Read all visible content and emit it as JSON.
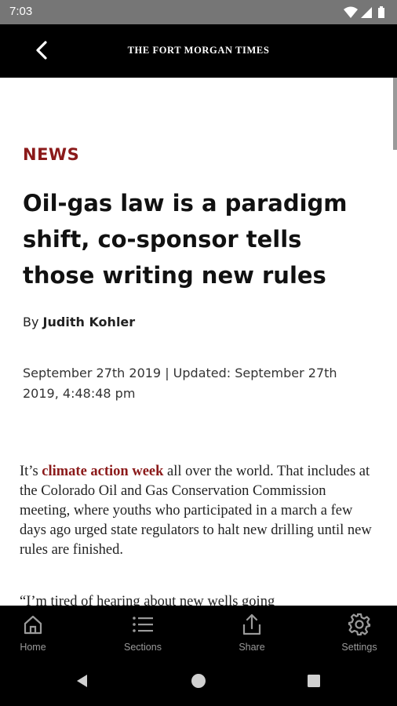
{
  "status_bar": {
    "time": "7:03",
    "icons": [
      "wifi-icon",
      "signal-icon",
      "battery-icon"
    ]
  },
  "app_bar": {
    "back_icon": "chevron-left-icon",
    "masthead": "THE FORT MORGAN TIMES"
  },
  "article": {
    "section": "NEWS",
    "headline": "Oil-gas law is a paradigm shift, co-sponsor tells those writing new rules",
    "byline_prefix": "By",
    "author": "Judith Kohler",
    "dateline": "September 27th 2019 | Updated: September 27th 2019, 4:48:48 pm",
    "body": {
      "intro": "It’s",
      "link": "climate action week",
      "rest": " all over the world. That includes at the Colorado Oil and Gas Conservation Commission meeting, where youths who participated in a march a few days ago urged state regulators to halt new drilling until new rules are finished."
    },
    "body_next": "“I’m tired of hearing about new wells going"
  },
  "bottom_nav": {
    "items": [
      {
        "label": "Home",
        "icon": "home-icon"
      },
      {
        "label": "Sections",
        "icon": "list-icon"
      },
      {
        "label": "Share",
        "icon": "share-icon"
      },
      {
        "label": "Settings",
        "icon": "gear-icon"
      }
    ]
  },
  "system_nav": {
    "buttons": [
      "back-triangle-icon",
      "home-circle-icon",
      "recents-square-icon"
    ]
  },
  "colors": {
    "accent": "#8b1a1a",
    "status_bar": "#767676",
    "app_bar": "#000000",
    "nav_label": "#9a9a9a"
  }
}
